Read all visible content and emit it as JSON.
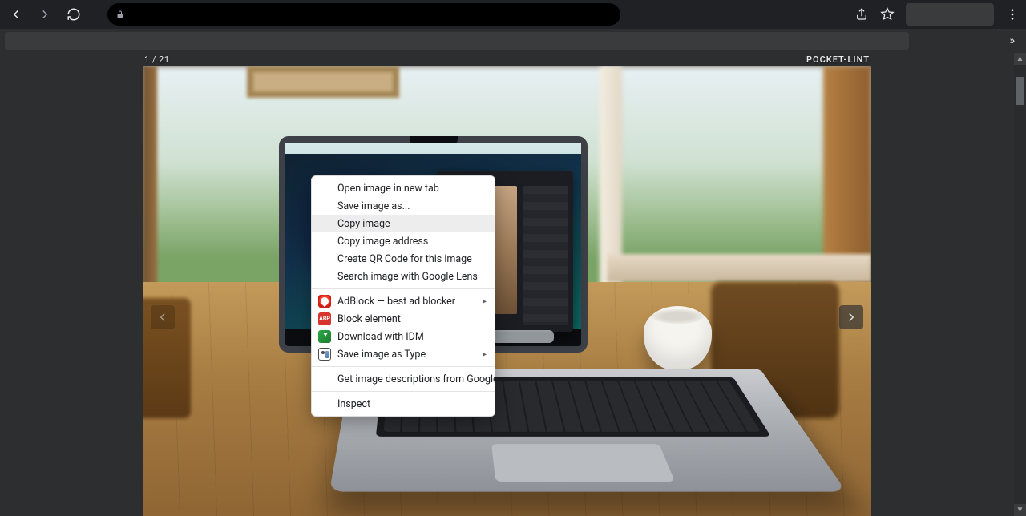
{
  "gallery": {
    "counter": "1 / 21",
    "brand": "POCKET-LINT"
  },
  "context_menu": {
    "open_new_tab": "Open image in new tab",
    "save_as": "Save image as...",
    "copy_image": "Copy image",
    "copy_addr": "Copy image address",
    "qr": "Create QR Code for this image",
    "lens": "Search image with Google Lens",
    "adblock": "AdBlock — best ad blocker",
    "block_elem": "Block element",
    "idm": "Download with IDM",
    "save_type": "Save image as Type",
    "img_desc": "Get image descriptions from Google",
    "inspect": "Inspect"
  },
  "icon_labels": {
    "abp": "ABP"
  }
}
